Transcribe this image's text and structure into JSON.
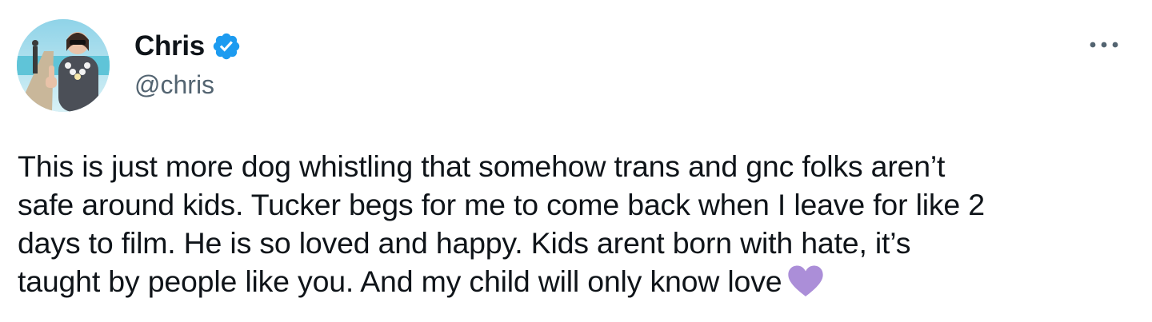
{
  "author": {
    "display_name": "Chris",
    "handle": "@chris",
    "verified": true
  },
  "icons": {
    "avatar": "avatar",
    "verified": "verified-badge-icon",
    "more": "more-options-icon",
    "emoji": "purple-heart-icon"
  },
  "colors": {
    "verified_blue": "#1d9bf0",
    "handle_gray": "#536471",
    "text": "#0f1419",
    "heart_purple": "#ab8ed8"
  },
  "tweet": {
    "lines": [
      "This is just more dog whistling that somehow trans and gnc folks aren’t",
      "safe around kids. Tucker begs for me to come back when I leave for like 2",
      "days to film. He is so loved and happy. Kids arent born with hate, it’s",
      "taught by people like you. And my child will only know love"
    ],
    "emoji": "💜"
  }
}
